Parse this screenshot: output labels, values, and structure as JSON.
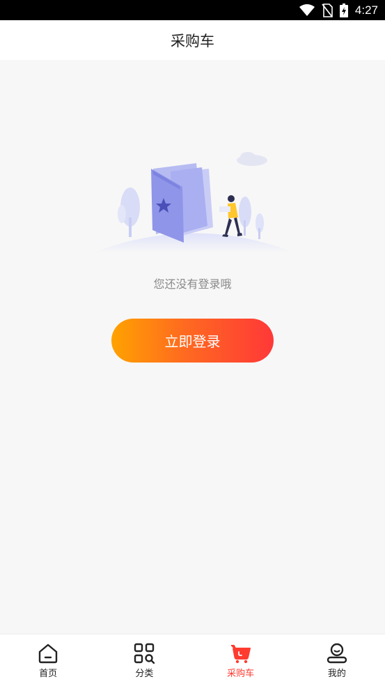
{
  "status_bar": {
    "time": "4:27",
    "icons": [
      "wifi-icon",
      "no-sim-icon",
      "battery-charging-icon"
    ]
  },
  "header": {
    "title": "采购车"
  },
  "empty_state": {
    "illustration": "open-book-illustration",
    "message": "您还没有登录哦"
  },
  "login_button": {
    "label": "立即登录"
  },
  "colors": {
    "accent": "#ff3b30",
    "gradient_start": "#ffa200",
    "gradient_end": "#ff3838",
    "illustration": "#8f95e8"
  },
  "tab_bar": {
    "active": "采购车",
    "items": [
      {
        "label": "首页",
        "icon": "home-icon"
      },
      {
        "label": "分类",
        "icon": "category-icon"
      },
      {
        "label": "采购车",
        "icon": "cart-icon"
      },
      {
        "label": "我的",
        "icon": "profile-icon"
      }
    ]
  }
}
